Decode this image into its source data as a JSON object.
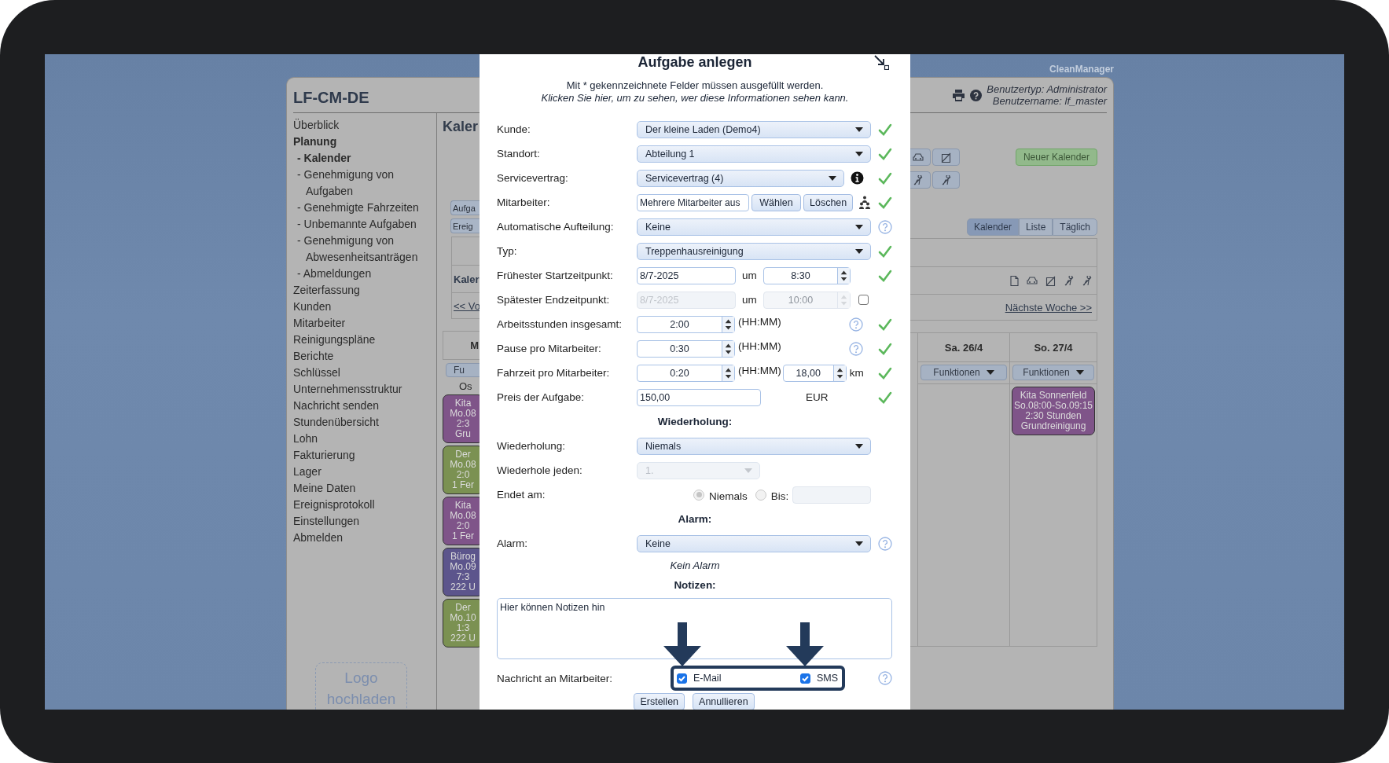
{
  "app_name": "CleanManager",
  "header": {
    "title": "LF-CM-DE",
    "user_type": "Benutzertyp: Administrator",
    "user_name": "Benutzername: lf_master"
  },
  "sidebar": {
    "items": [
      {
        "label": "Überblick",
        "selected": false
      },
      {
        "label": "Planung",
        "selected": true,
        "children": [
          {
            "label": "- Kalender",
            "selected": true
          },
          {
            "label": "- Genehmigung von Aufgaben",
            "selected": false
          },
          {
            "label": "- Genehmigte Fahrzeiten",
            "selected": false
          },
          {
            "label": "- Unbemannte Aufgaben",
            "selected": false
          },
          {
            "label": "- Genehmigung von Abwesenheitsanträgen",
            "selected": false
          },
          {
            "label": "- Abmeldungen",
            "selected": false
          }
        ]
      },
      {
        "label": "Zeiterfassung",
        "selected": false
      },
      {
        "label": "Kunden",
        "selected": false
      },
      {
        "label": "Mitarbeiter",
        "selected": false
      },
      {
        "label": "Reinigungspläne",
        "selected": false
      },
      {
        "label": "Berichte",
        "selected": false
      },
      {
        "label": "Schlüssel",
        "selected": false
      },
      {
        "label": "Unternehmensstruktur",
        "selected": false
      },
      {
        "label": "Nachricht senden",
        "selected": false
      },
      {
        "label": "Stundenübersicht",
        "selected": false
      },
      {
        "label": "Lohn",
        "selected": false
      },
      {
        "label": "Fakturierung",
        "selected": false
      },
      {
        "label": "Lager",
        "selected": false
      },
      {
        "label": "Meine Daten",
        "selected": false
      },
      {
        "label": "Ereignisprotokoll",
        "selected": false
      },
      {
        "label": "Einstellungen",
        "selected": false
      },
      {
        "label": "Abmelden",
        "selected": false
      }
    ],
    "logo_upload": "Logo hochladen"
  },
  "calendar_left": {
    "heading": "Kaler",
    "buttons": [
      "Aufga",
      "Ereig"
    ],
    "subheading": "Kaler",
    "prev_week_link": "<< Vo",
    "day_header": "M",
    "functions_button": "Fu",
    "label": "Os",
    "events": [
      {
        "lines": [
          "Kita",
          "Mo.08",
          "2:3",
          "Gru"
        ],
        "color": "#7f5489"
      },
      {
        "lines": [
          "Der",
          "Mo.08",
          "2:0",
          "1 Fer"
        ],
        "color": "#7b9152"
      },
      {
        "lines": [
          "Kita",
          "Mo.08",
          "2:0",
          "1 Fer"
        ],
        "color": "#7f5489"
      },
      {
        "lines": [
          "Bürog",
          "Mo.09",
          "7:3",
          "222 U"
        ],
        "color": "#5c558c"
      },
      {
        "lines": [
          "Der",
          "Mo.10",
          "1:3",
          "222 U"
        ],
        "color": "#7b9152"
      }
    ]
  },
  "calendar_right": {
    "new_calendar_button": "Neuer Kalender",
    "views": [
      {
        "label": "Kalender",
        "selected": true
      },
      {
        "label": "Liste",
        "selected": false
      },
      {
        "label": "Täglich",
        "selected": false
      }
    ],
    "next_week_link": "Nächste Woche >>",
    "days": [
      {
        "header": "Sa. 26/4",
        "functions_button": "Funktionen"
      },
      {
        "header": "So. 27/4",
        "functions_button": "Funktionen",
        "events": [
          {
            "lines": [
              "Kita Sonnenfeld",
              "So.08:00-So.09:15",
              "2:30 Stunden",
              "Grundreinigung"
            ],
            "color": "#7f5489"
          }
        ]
      }
    ]
  },
  "dialog": {
    "title": "Aufgabe anlegen",
    "notice": "Mit * gekennzeichnete Felder müssen ausgefüllt werden.",
    "visibility_link": "Klicken Sie hier, um zu sehen, wer diese Informationen sehen kann.",
    "rows": [
      {
        "kind": "select",
        "label": "Kunde:",
        "value": "Der kleine Laden (Demo4)",
        "disabled": false,
        "help": false,
        "valid": true
      },
      {
        "kind": "select",
        "label": "Standort:",
        "value": "Abteilung 1",
        "disabled": false,
        "help": false,
        "valid": true
      },
      {
        "kind": "select_info",
        "label": "Servicevertrag:",
        "value": "Servicevertrag (4)",
        "help": false,
        "valid": true
      },
      {
        "kind": "employees",
        "label": "Mitarbeiter:",
        "value": "Mehrere Mitarbeiter aus",
        "buttons": [
          "Wählen",
          "Löschen"
        ],
        "help": false,
        "valid": true
      },
      {
        "kind": "select",
        "label": "Automatische Aufteilung:",
        "value": "Keine",
        "disabled": false,
        "help": true,
        "valid": false
      },
      {
        "kind": "select",
        "label": "Typ:",
        "value": "Treppenhausreinigung",
        "disabled": false,
        "help": false,
        "valid": true
      },
      {
        "kind": "datetime",
        "label": "Frühester Startzeitpunkt:",
        "date": "8/7-2025",
        "joiner": "um",
        "time": "8:30",
        "help": false,
        "valid": true
      },
      {
        "kind": "datetime_optional",
        "label": "Spätester Endzeitpunkt:",
        "date": "8/7-2025",
        "joiner": "um",
        "time": "10:00",
        "checked": false,
        "help": false,
        "valid": false
      },
      {
        "kind": "duration",
        "label": "Arbeitsstunden insgesamt:",
        "value": "2:00",
        "unit": "(HH:MM)",
        "help": true,
        "valid": true
      },
      {
        "kind": "duration",
        "label": "Pause pro Mitarbeiter:",
        "value": "0:30",
        "unit": "(HH:MM)",
        "help": true,
        "valid": true
      },
      {
        "kind": "duration_distance",
        "label": "Fahrzeit pro Mitarbeiter:",
        "value": "0:20",
        "unit": "(HH:MM)",
        "distance": "18,00",
        "distance_unit": "km",
        "help": false,
        "valid": true
      },
      {
        "kind": "price",
        "label": "Preis der Aufgabe:",
        "value": "150,00",
        "currency": "EUR",
        "help": false,
        "valid": true
      },
      {
        "kind": "heading",
        "text": "Wiederholung:"
      },
      {
        "kind": "select",
        "label": "Wiederholung:",
        "value": "Niemals",
        "disabled": false,
        "help": false,
        "valid": false
      },
      {
        "kind": "select",
        "label": "Wiederhole jeden:",
        "value": "1.",
        "disabled": true,
        "help": false,
        "valid": false
      },
      {
        "kind": "end_choice",
        "label": "Endet am:",
        "options": [
          {
            "label": "Niemals",
            "selected": true
          },
          {
            "label": "Bis:",
            "selected": false
          }
        ],
        "disabled": true,
        "help": false,
        "valid": false
      },
      {
        "kind": "heading",
        "text": "Alarm:"
      },
      {
        "kind": "select",
        "label": "Alarm:",
        "value": "Keine",
        "disabled": false,
        "help": true,
        "valid": false
      },
      {
        "kind": "note",
        "text": "Kein Alarm"
      },
      {
        "kind": "heading",
        "text": "Notizen:"
      },
      {
        "kind": "textarea",
        "value": "Hier können Notizen hin"
      },
      {
        "kind": "notify",
        "label": "Nachricht an Mitarbeiter:",
        "options": [
          {
            "label": "E-Mail",
            "checked": true
          },
          {
            "label": "SMS",
            "checked": true
          }
        ],
        "highlighted": true,
        "help": true,
        "valid": false
      }
    ],
    "buttons": [
      "Erstellen",
      "Annullieren"
    ]
  }
}
